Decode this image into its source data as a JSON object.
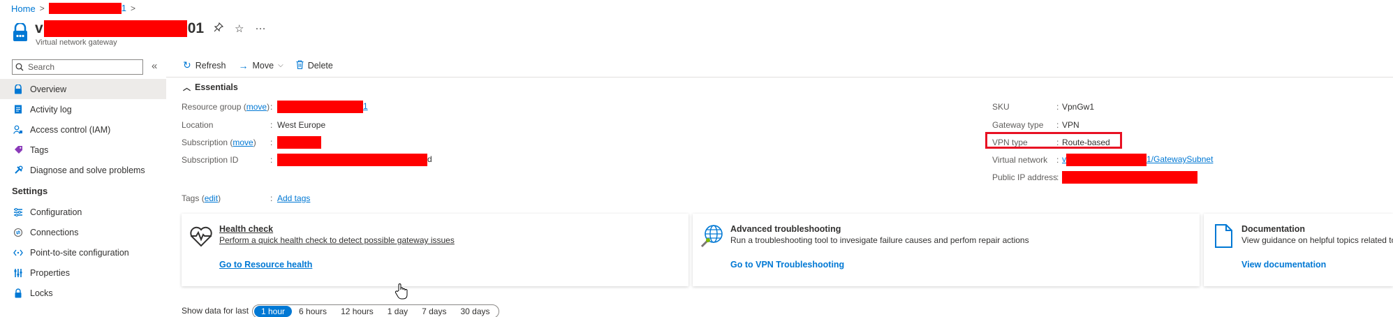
{
  "breadcrumb": {
    "home": "Home",
    "item_suffix": "1",
    "separator": ">"
  },
  "header": {
    "title_prefix": "v",
    "title_suffix": "01",
    "subtitle": "Virtual network gateway",
    "pin_icon": "pin-icon",
    "star_icon": "star-icon",
    "more": "···"
  },
  "nav": {
    "search_placeholder": "Search",
    "collapse": "«",
    "items": [
      {
        "label": "Overview",
        "icon": "overview-icon",
        "active": true
      },
      {
        "label": "Activity log",
        "icon": "activity-log-icon"
      },
      {
        "label": "Access control (IAM)",
        "icon": "iam-icon"
      },
      {
        "label": "Tags",
        "icon": "tag-icon"
      },
      {
        "label": "Diagnose and solve problems",
        "icon": "wrench-icon"
      }
    ],
    "section": "Settings",
    "settings_items": [
      {
        "label": "Configuration",
        "icon": "configuration-icon"
      },
      {
        "label": "Connections",
        "icon": "connections-icon"
      },
      {
        "label": "Point-to-site configuration",
        "icon": "point-to-site-icon"
      },
      {
        "label": "Properties",
        "icon": "properties-icon"
      },
      {
        "label": "Locks",
        "icon": "lock-icon"
      }
    ]
  },
  "toolbar": {
    "refresh": "Refresh",
    "move": "Move",
    "delete": "Delete"
  },
  "essentials": {
    "heading": "Essentials",
    "left": {
      "resource_group_label": "Resource group",
      "move_link": "move",
      "resource_group_suffix": "1",
      "location_label": "Location",
      "location_value": "West Europe",
      "subscription_label": "Subscription",
      "subscription_id_label": "Subscription ID",
      "subscription_id_suffix": "d",
      "tags_label": "Tags",
      "edit_link": "edit",
      "add_tags": "Add tags"
    },
    "right": {
      "sku_label": "SKU",
      "sku_value": "VpnGw1",
      "gateway_type_label": "Gateway type",
      "gateway_type_value": "VPN",
      "vpn_type_label": "VPN type",
      "vpn_type_value": "Route-based",
      "vnet_label": "Virtual network",
      "vnet_prefix": "v",
      "vnet_suffix": "1/GatewaySubnet",
      "public_ip_label": "Public IP address"
    }
  },
  "cards": [
    {
      "title": "Health check",
      "desc": "Perform a quick health check to detect possible gateway issues",
      "link": "Go to Resource health",
      "icon": "heart-pulse-icon"
    },
    {
      "title": "Advanced troubleshooting",
      "desc": "Run a troubleshooting tool to invesigate failure causes and perfom repair actions",
      "link": "Go to VPN Troubleshooting",
      "icon": "globe-wrench-icon"
    },
    {
      "title": "Documentation",
      "desc": "View guidance on helpful topics related to",
      "link": "View documentation",
      "icon": "document-icon"
    }
  ],
  "time_range": {
    "label": "Show data for last",
    "options": [
      "1 hour",
      "6 hours",
      "12 hours",
      "1 day",
      "7 days",
      "30 days"
    ],
    "selected": "1 hour"
  },
  "colors": {
    "accent": "#0078d4",
    "redaction": "#ff0000",
    "highlight_border": "#e81123"
  }
}
